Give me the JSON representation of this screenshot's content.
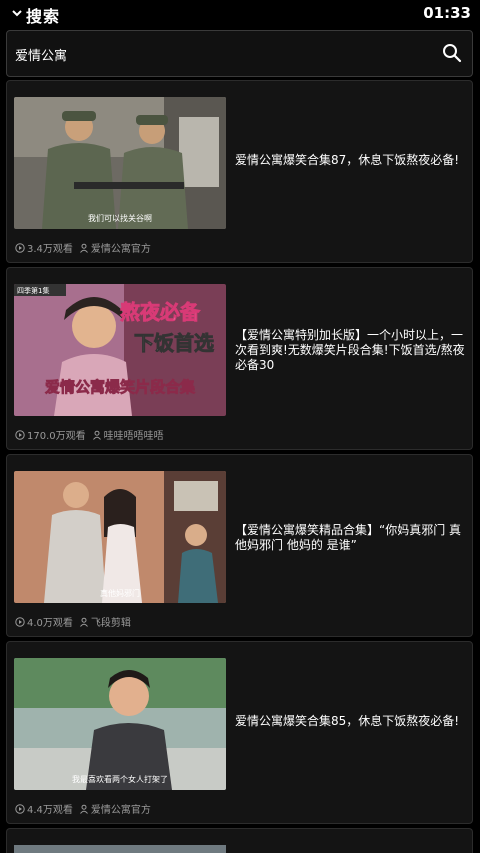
{
  "header": {
    "title": "搜索",
    "time": "01:33"
  },
  "search": {
    "query": "爱情公寓"
  },
  "videos": [
    {
      "title": "爱情公寓爆笑合集87，休息下饭熬夜必备!",
      "views": "3.4万观看",
      "author": "爱情公寓官方",
      "caption": "我们可以找关谷啊"
    },
    {
      "title": "【爱情公寓特别加长版】一个小时以上，一次看到爽!无数爆笑片段合集!下饭首选/熬夜必备30",
      "views": "170.0万观看",
      "author": "哇哇唔唔哇唔",
      "badge": "四季第1集",
      "overlay_1": "熬夜必备",
      "overlay_2": "下饭首选",
      "overlay_3": "爱情公寓爆笑片段合集"
    },
    {
      "title": "【爱情公寓爆笑精品合集】“你妈真邪门 真他妈邪门 他妈的 是谁”",
      "views": "4.0万观看",
      "author": "飞段剪辑",
      "caption": "真他妈邪门"
    },
    {
      "title": "爱情公寓爆笑合集85，休息下饭熬夜必备!",
      "views": "4.4万观看",
      "author": "爱情公寓官方",
      "caption": "我最喜欢看两个女人打架了"
    }
  ]
}
